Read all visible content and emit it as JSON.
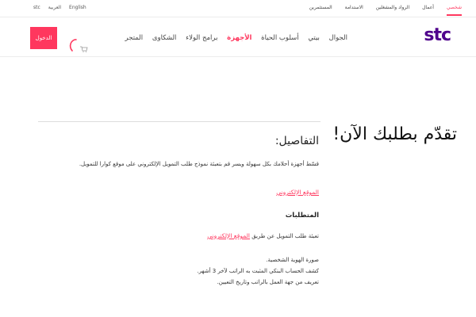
{
  "topbar": {
    "left_items": [
      "stc",
      "العربية",
      "English"
    ],
    "nav": [
      "شخصي",
      "أعمال",
      "الرواد والمشغلين",
      "الاستدامة",
      "المستثمرين"
    ]
  },
  "header": {
    "logo": "stc",
    "nav": [
      "الجوال",
      "بيتي",
      "أسلوب الحياة",
      "الأجهزة",
      "برامج الولاء",
      "الشكاوى",
      "المتجر"
    ],
    "login": "الدخول"
  },
  "hero": {
    "title": "تقدّم بطلبك الآن!"
  },
  "details": {
    "heading": "التفاصيل:",
    "description": "قسّط أجهزة أحلامك بكل سهولة ويسر قم بتعبئة نموذج طلب التمويل الإلكتروني على موقع كوارا للتمويل.",
    "link1": "الموقع الإلكتروني",
    "requirements_title": "المتطلبات",
    "apply_prefix": "تعبئة طلب التمويل عن طريق",
    "link2": "الموقع الإلكتروني",
    "req_items": [
      "صورة الهوية الشخصية.",
      "كشف الحساب البنكي المثبت به الراتب لآخر 3 أشهر.",
      "تعريف من جهة العمل بالراتب وتاريخ التعيين."
    ]
  },
  "colors": {
    "accent": "#ff375e",
    "brand": "#4f008c"
  }
}
